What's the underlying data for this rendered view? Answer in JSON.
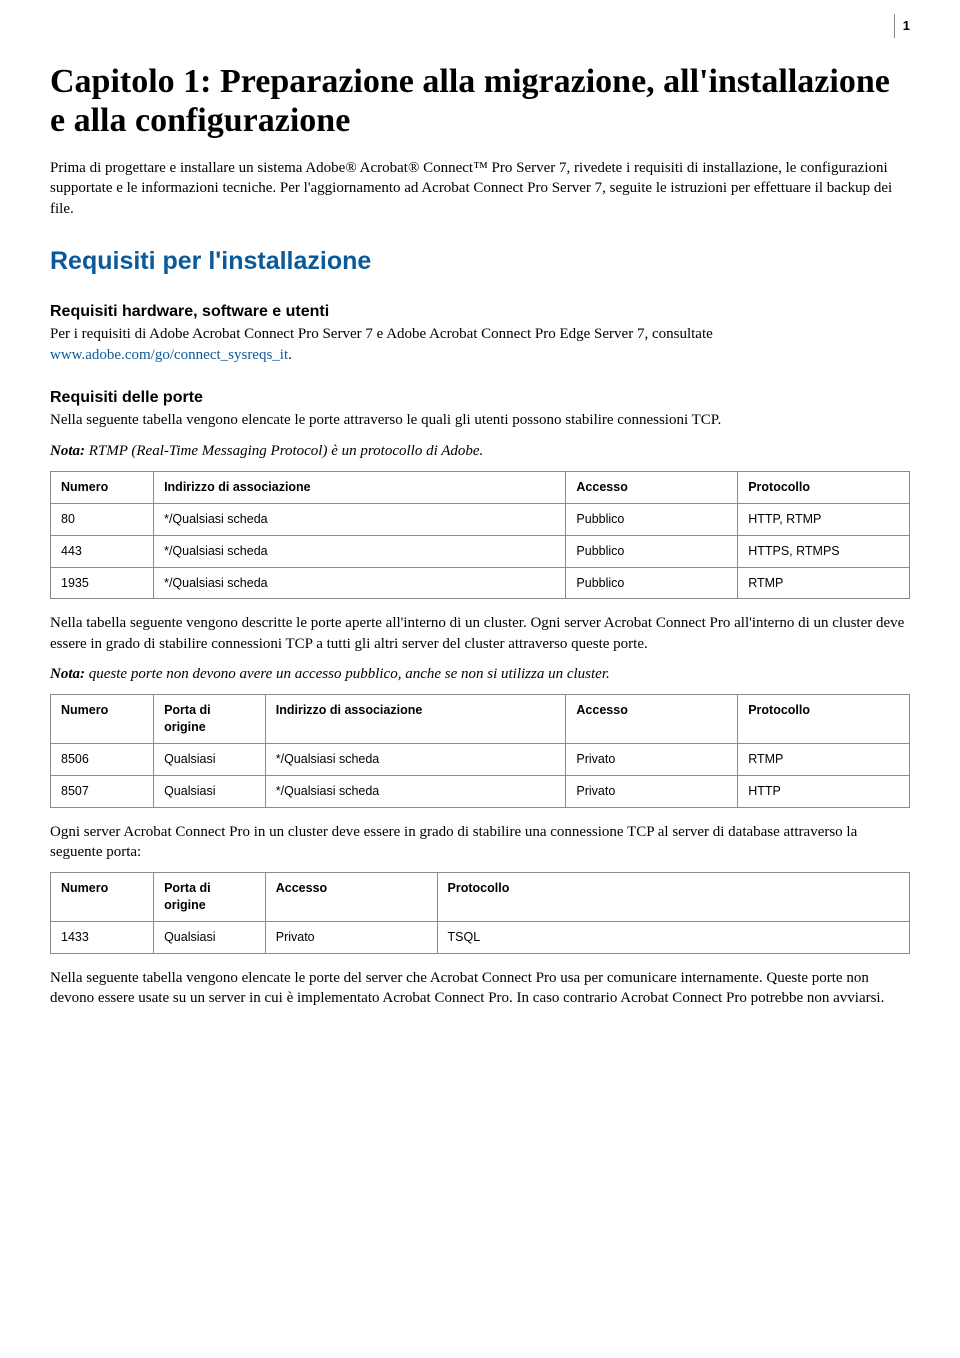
{
  "page_number": "1",
  "chapter_title": "Capitolo 1: Preparazione alla migrazione, all'installazione e alla configurazione",
  "intro": "Prima di progettare e installare un sistema Adobe® Acrobat® Connect™ Pro Server 7, rivedete i requisiti di installazione, le configurazioni supportate e le informazioni tecniche. Per l'aggiornamento ad Acrobat Connect Pro Server 7, seguite le istruzioni per effettuare il backup dei file.",
  "section_heading": "Requisiti per l'installazione",
  "sub_hw": {
    "heading": "Requisiti hardware, software e utenti",
    "text_before_link": "Per i requisiti di Adobe Acrobat Connect Pro Server 7 e Adobe Acrobat Connect Pro Edge Server 7, consultate ",
    "link_text": "www.adobe.com/go/connect_sysreqs_it",
    "text_after_link": "."
  },
  "sub_ports": {
    "heading": "Requisiti delle porte",
    "text": "Nella seguente tabella vengono elencate le porte attraverso le quali gli utenti possono stabilire connessioni TCP.",
    "note_label": "Nota:",
    "note_text": " RTMP (Real-Time Messaging Protocol) è un protocollo di Adobe."
  },
  "table1": {
    "headers": [
      "Numero",
      "Indirizzo di associazione",
      "Accesso",
      "Protocollo"
    ],
    "rows": [
      [
        "80",
        "*/Qualsiasi scheda",
        "Pubblico",
        "HTTP, RTMP"
      ],
      [
        "443",
        "*/Qualsiasi scheda",
        "Pubblico",
        "HTTPS, RTMPS"
      ],
      [
        "1935",
        "*/Qualsiasi scheda",
        "Pubblico",
        "RTMP"
      ]
    ]
  },
  "cluster_text": "Nella tabella seguente vengono descritte le porte aperte all'interno di un cluster. Ogni server Acrobat Connect Pro all'interno di un cluster deve essere in grado di stabilire connessioni TCP a tutti gli altri server del cluster attraverso queste porte.",
  "cluster_note_label": "Nota:",
  "cluster_note_text": " queste porte non devono avere un accesso pubblico, anche se non si utilizza un cluster.",
  "table2": {
    "headers": [
      "Numero",
      "Porta di origine",
      "Indirizzo di associazione",
      "Accesso",
      "Protocollo"
    ],
    "rows": [
      [
        "8506",
        "Qualsiasi",
        "*/Qualsiasi scheda",
        "Privato",
        "RTMP"
      ],
      [
        "8507",
        "Qualsiasi",
        "*/Qualsiasi scheda",
        "Privato",
        "HTTP"
      ]
    ]
  },
  "db_text": "Ogni server Acrobat Connect Pro in un cluster deve essere in grado di stabilire una connessione TCP al server di database attraverso la seguente porta:",
  "table3": {
    "headers": [
      "Numero",
      "Porta di origine",
      "Accesso",
      "Protocollo"
    ],
    "rows": [
      [
        "1433",
        "Qualsiasi",
        "Privato",
        "TSQL"
      ]
    ]
  },
  "internal_text": "Nella seguente tabella vengono elencate le porte del server che Acrobat Connect Pro usa per comunicare internamente. Queste porte non devono essere usate su un server in cui è implementato Acrobat Connect Pro. In caso contrario Acrobat Connect Pro potrebbe non avviarsi."
}
